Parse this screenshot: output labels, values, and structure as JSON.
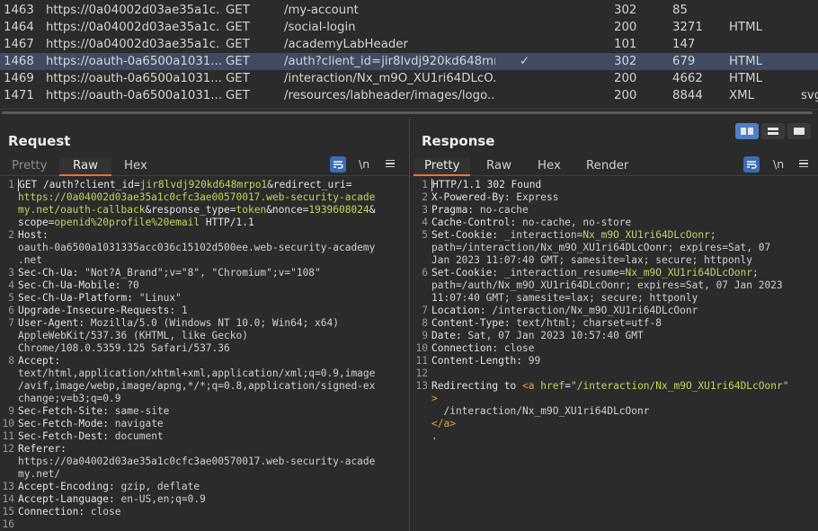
{
  "history": {
    "rows": [
      {
        "id": "1463",
        "host": "https://0a04002d03ae35a1c...",
        "method": "GET",
        "url": "/my-account",
        "check": "",
        "status": "302",
        "length": "85",
        "mime": "",
        "ext": ""
      },
      {
        "id": "1464",
        "host": "https://0a04002d03ae35a1c...",
        "method": "GET",
        "url": "/social-login",
        "check": "",
        "status": "200",
        "length": "3271",
        "mime": "HTML",
        "ext": ""
      },
      {
        "id": "1467",
        "host": "https://0a04002d03ae35a1c...",
        "method": "GET",
        "url": "/academyLabHeader",
        "check": "",
        "status": "101",
        "length": "147",
        "mime": "",
        "ext": ""
      },
      {
        "id": "1468",
        "host": "https://oauth-0a6500a1031...",
        "method": "GET",
        "url": "/auth?client_id=jir8lvdj920kd648mr...",
        "check": "✓",
        "status": "302",
        "length": "679",
        "mime": "HTML",
        "ext": ""
      },
      {
        "id": "1469",
        "host": "https://oauth-0a6500a1031...",
        "method": "GET",
        "url": "/interaction/Nx_m9O_XU1ri64DLcO...",
        "check": "",
        "status": "200",
        "length": "4662",
        "mime": "HTML",
        "ext": ""
      },
      {
        "id": "1471",
        "host": "https://oauth-0a6500a1031...",
        "method": "GET",
        "url": "/resources/labheader/images/logo...",
        "check": "",
        "status": "200",
        "length": "8844",
        "mime": "XML",
        "ext": "svg"
      }
    ],
    "selected_index": 3
  },
  "request": {
    "title": "Request",
    "tabs": [
      "Pretty",
      "Raw",
      "Hex"
    ],
    "active_tab": "Raw",
    "newline_label": "\\n",
    "lines": [
      {
        "n": "1",
        "segs": [
          [
            "k",
            "GET /auth?client_id="
          ],
          [
            "u",
            "jir8lvdj920kd648mrpo1"
          ],
          [
            "k",
            "&redirect_uri="
          ]
        ]
      },
      {
        "n": "",
        "segs": [
          [
            "u",
            "https://0a04002d03ae35a1c0cfc3ae00570017.web-security-acade"
          ]
        ]
      },
      {
        "n": "",
        "segs": [
          [
            "u",
            "my.net/oauth-callback"
          ],
          [
            "k",
            "&response_type="
          ],
          [
            "u",
            "token"
          ],
          [
            "k",
            "&nonce="
          ],
          [
            "u",
            "1939608024"
          ],
          [
            "k",
            "&"
          ]
        ]
      },
      {
        "n": "",
        "segs": [
          [
            "k",
            "scope="
          ],
          [
            "u",
            "openid%20profile%20email"
          ],
          [
            "k",
            " HTTP/1.1"
          ]
        ]
      },
      {
        "n": "2",
        "segs": [
          [
            "k",
            "Host:"
          ]
        ]
      },
      {
        "n": "",
        "segs": [
          [
            "v",
            "oauth-0a6500a1031335acc036c15102d500ee.web-security-academy"
          ]
        ]
      },
      {
        "n": "",
        "segs": [
          [
            "v",
            ".net"
          ]
        ]
      },
      {
        "n": "3",
        "segs": [
          [
            "k",
            "Sec-Ch-Ua:"
          ],
          [
            "v",
            " \"Not?A_Brand\";v=\"8\", \"Chromium\";v=\"108\""
          ]
        ]
      },
      {
        "n": "4",
        "segs": [
          [
            "k",
            "Sec-Ch-Ua-Mobile:"
          ],
          [
            "v",
            " ?0"
          ]
        ]
      },
      {
        "n": "5",
        "segs": [
          [
            "k",
            "Sec-Ch-Ua-Platform:"
          ],
          [
            "v",
            " \"Linux\""
          ]
        ]
      },
      {
        "n": "6",
        "segs": [
          [
            "k",
            "Upgrade-Insecure-Requests:"
          ],
          [
            "v",
            " 1"
          ]
        ]
      },
      {
        "n": "7",
        "segs": [
          [
            "k",
            "User-Agent:"
          ],
          [
            "v",
            " Mozilla/5.0 (Windows NT 10.0; Win64; x64)"
          ]
        ]
      },
      {
        "n": "",
        "segs": [
          [
            "v",
            "AppleWebKit/537.36 (KHTML, like Gecko)"
          ]
        ]
      },
      {
        "n": "",
        "segs": [
          [
            "v",
            "Chrome/108.0.5359.125 Safari/537.36"
          ]
        ]
      },
      {
        "n": "8",
        "segs": [
          [
            "k",
            "Accept:"
          ]
        ]
      },
      {
        "n": "",
        "segs": [
          [
            "v",
            "text/html,application/xhtml+xml,application/xml;q=0.9,image"
          ]
        ]
      },
      {
        "n": "",
        "segs": [
          [
            "v",
            "/avif,image/webp,image/apng,*/*;q=0.8,application/signed-ex"
          ]
        ]
      },
      {
        "n": "",
        "segs": [
          [
            "v",
            "change;v=b3;q=0.9"
          ]
        ]
      },
      {
        "n": "9",
        "segs": [
          [
            "k",
            "Sec-Fetch-Site:"
          ],
          [
            "v",
            " same-site"
          ]
        ]
      },
      {
        "n": "10",
        "segs": [
          [
            "k",
            "Sec-Fetch-Mode:"
          ],
          [
            "v",
            " navigate"
          ]
        ]
      },
      {
        "n": "11",
        "segs": [
          [
            "k",
            "Sec-Fetch-Dest:"
          ],
          [
            "v",
            " document"
          ]
        ]
      },
      {
        "n": "12",
        "segs": [
          [
            "k",
            "Referer:"
          ]
        ]
      },
      {
        "n": "",
        "segs": [
          [
            "v",
            "https://0a04002d03ae35a1c0cfc3ae00570017.web-security-acade"
          ]
        ]
      },
      {
        "n": "",
        "segs": [
          [
            "v",
            "my.net/"
          ]
        ]
      },
      {
        "n": "13",
        "segs": [
          [
            "k",
            "Accept-Encoding:"
          ],
          [
            "v",
            " gzip, deflate"
          ]
        ]
      },
      {
        "n": "14",
        "segs": [
          [
            "k",
            "Accept-Language:"
          ],
          [
            "v",
            " en-US,en;q=0.9"
          ]
        ]
      },
      {
        "n": "15",
        "segs": [
          [
            "k",
            "Connection:"
          ],
          [
            "v",
            " close"
          ]
        ]
      },
      {
        "n": "16",
        "segs": []
      },
      {
        "n": "17",
        "segs": []
      }
    ]
  },
  "response": {
    "title": "Response",
    "tabs": [
      "Pretty",
      "Raw",
      "Hex",
      "Render"
    ],
    "active_tab": "Pretty",
    "newline_label": "\\n",
    "lines": [
      {
        "n": "1",
        "segs": [
          [
            "k",
            "HTTP/1.1 302 Found"
          ]
        ]
      },
      {
        "n": "2",
        "segs": [
          [
            "k",
            "X-Powered-By:"
          ],
          [
            "v",
            " Express"
          ]
        ]
      },
      {
        "n": "3",
        "segs": [
          [
            "k",
            "Pragma:"
          ],
          [
            "v",
            " no-cache"
          ]
        ]
      },
      {
        "n": "4",
        "segs": [
          [
            "k",
            "Cache-Control:"
          ],
          [
            "v",
            " no-cache, no-store"
          ]
        ]
      },
      {
        "n": "5",
        "segs": [
          [
            "k",
            "Set-Cookie:"
          ],
          [
            "v",
            " _interaction="
          ],
          [
            "u",
            "Nx_m9O_XU1ri64DLcOonr"
          ],
          [
            "v",
            ";"
          ]
        ]
      },
      {
        "n": "",
        "segs": [
          [
            "v",
            "path=/interaction/Nx_m9O_XU1ri64DLcOonr; expires=Sat, 07"
          ]
        ]
      },
      {
        "n": "",
        "segs": [
          [
            "v",
            "Jan 2023 11:07:40 GMT; samesite=lax; secure; httponly"
          ]
        ]
      },
      {
        "n": "6",
        "segs": [
          [
            "k",
            "Set-Cookie:"
          ],
          [
            "v",
            " _interaction_resume="
          ],
          [
            "u",
            "Nx_m9O_XU1ri64DLcOonr"
          ],
          [
            "v",
            ";"
          ]
        ]
      },
      {
        "n": "",
        "segs": [
          [
            "v",
            "path=/auth/Nx_m9O_XU1ri64DLcOonr; expires=Sat, 07 Jan 2023"
          ]
        ]
      },
      {
        "n": "",
        "segs": [
          [
            "v",
            "11:07:40 GMT; samesite=lax; secure; httponly"
          ]
        ]
      },
      {
        "n": "7",
        "segs": [
          [
            "k",
            "Location:"
          ],
          [
            "v",
            " /interaction/Nx_m9O_XU1ri64DLcOonr"
          ]
        ]
      },
      {
        "n": "8",
        "segs": [
          [
            "k",
            "Content-Type:"
          ],
          [
            "v",
            " text/html; charset=utf-8"
          ]
        ]
      },
      {
        "n": "9",
        "segs": [
          [
            "k",
            "Date:"
          ],
          [
            "v",
            " Sat, 07 Jan 2023 10:57:40 GMT"
          ]
        ]
      },
      {
        "n": "10",
        "segs": [
          [
            "k",
            "Connection:"
          ],
          [
            "v",
            " close"
          ]
        ]
      },
      {
        "n": "11",
        "segs": [
          [
            "k",
            "Content-Length:"
          ],
          [
            "v",
            " 99"
          ]
        ]
      },
      {
        "n": "12",
        "segs": []
      },
      {
        "n": "13",
        "segs": [
          [
            "k",
            "Redirecting to "
          ],
          [
            "t",
            "<a"
          ],
          [
            "k",
            " "
          ],
          [
            "u",
            "href"
          ],
          [
            "k",
            "="
          ],
          [
            "u",
            "\"/interaction/Nx_m9O_XU1ri64DLcOonr\""
          ]
        ]
      },
      {
        "n": "",
        "segs": [
          [
            "t",
            ">"
          ]
        ]
      },
      {
        "n": "",
        "segs": [
          [
            "v",
            "  /interaction/Nx_m9O_XU1ri64DLcOonr"
          ]
        ]
      },
      {
        "n": "",
        "segs": [
          [
            "t",
            "</a>"
          ]
        ]
      },
      {
        "n": "",
        "segs": [
          [
            "v",
            "."
          ]
        ]
      }
    ]
  },
  "colors": {
    "accent": "#e8743b",
    "selected_row": "#3f4b63",
    "wrap_button": "#3b6cb5"
  }
}
